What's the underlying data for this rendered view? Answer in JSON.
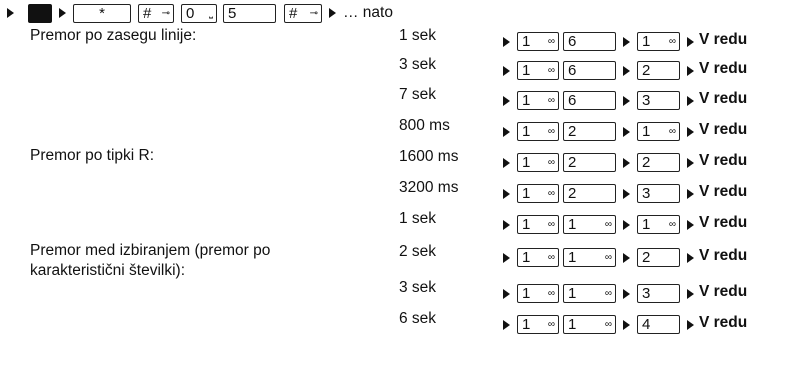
{
  "header": {
    "keys": [
      {
        "label": "",
        "symbol": "",
        "icon": "menu-key"
      },
      {
        "label": "*",
        "symbol": "",
        "icon": ""
      },
      {
        "label": "#",
        "symbol": "⊸",
        "icon": ""
      },
      {
        "label": "0",
        "symbol": "⎵",
        "icon": ""
      },
      {
        "label": "5",
        "symbol": "",
        "icon": ""
      },
      {
        "label": "#",
        "symbol": "⊸",
        "icon": ""
      }
    ],
    "suffix": "… nato"
  },
  "sections": [
    {
      "label": "Premor po zasegu linije:"
    },
    {
      "label": "Premor po tipki R:"
    },
    {
      "label": "Premor med izbiranjem (premor po karakteristični številki):",
      "lines": [
        "Premor med izbiranjem (premor po",
        "karakteristični številki):"
      ]
    }
  ],
  "rows": [
    {
      "value": "1 sek",
      "keys": [
        "1",
        "6",
        "1"
      ],
      "syms": [
        "∞",
        "",
        "∞"
      ],
      "ok": "V redu"
    },
    {
      "value": "3 sek",
      "keys": [
        "1",
        "6",
        "2"
      ],
      "syms": [
        "∞",
        "",
        ""
      ],
      "ok": "V redu"
    },
    {
      "value": "7 sek",
      "keys": [
        "1",
        "6",
        "3"
      ],
      "syms": [
        "∞",
        "",
        ""
      ],
      "ok": "V redu"
    },
    {
      "value": "800 ms",
      "keys": [
        "1",
        "2",
        "1"
      ],
      "syms": [
        "∞",
        "",
        "∞"
      ],
      "ok": "V redu"
    },
    {
      "value": "1600 ms",
      "keys": [
        "1",
        "2",
        "2"
      ],
      "syms": [
        "∞",
        "",
        ""
      ],
      "ok": "V redu"
    },
    {
      "value": "3200 ms",
      "keys": [
        "1",
        "2",
        "3"
      ],
      "syms": [
        "∞",
        "",
        ""
      ],
      "ok": "V redu"
    },
    {
      "value": "1 sek",
      "keys": [
        "1",
        "1",
        "1"
      ],
      "syms": [
        "∞",
        "∞",
        "∞"
      ],
      "ok": "V redu"
    },
    {
      "value": "2 sek",
      "keys": [
        "1",
        "1",
        "2"
      ],
      "syms": [
        "∞",
        "∞",
        ""
      ],
      "ok": "V redu"
    },
    {
      "value": "3 sek",
      "keys": [
        "1",
        "1",
        "3"
      ],
      "syms": [
        "∞",
        "∞",
        ""
      ],
      "ok": "V redu"
    },
    {
      "value": "6 sek",
      "keys": [
        "1",
        "1",
        "4"
      ],
      "syms": [
        "∞",
        "∞",
        ""
      ],
      "ok": "V redu"
    }
  ]
}
